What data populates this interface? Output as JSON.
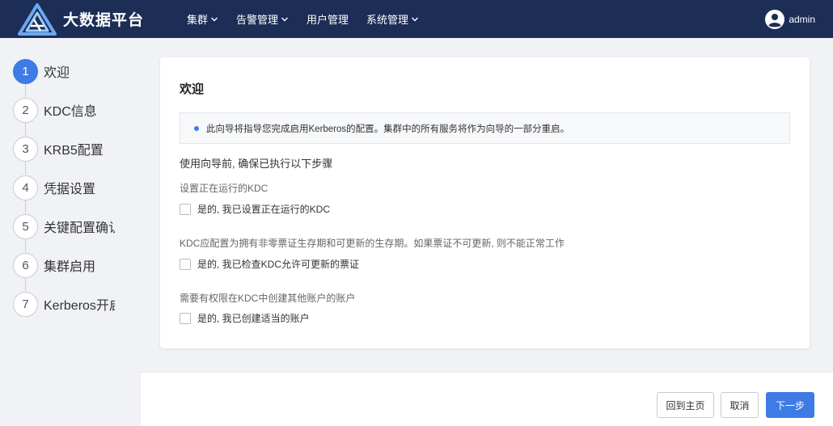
{
  "app": {
    "title": "大数据平台"
  },
  "nav": {
    "items": [
      {
        "label": "集群",
        "has_dropdown": true
      },
      {
        "label": "告警管理",
        "has_dropdown": true
      },
      {
        "label": "用户管理",
        "has_dropdown": false
      },
      {
        "label": "系统管理",
        "has_dropdown": true
      }
    ]
  },
  "user": {
    "name": "admin"
  },
  "steps": [
    {
      "number": "1",
      "label": "欢迎",
      "active": true
    },
    {
      "number": "2",
      "label": "KDC信息"
    },
    {
      "number": "3",
      "label": "KRB5配置"
    },
    {
      "number": "4",
      "label": "凭据设置"
    },
    {
      "number": "5",
      "label": "关键配置确认"
    },
    {
      "number": "6",
      "label": "集群启用"
    },
    {
      "number": "7",
      "label": "Kerberos开启"
    }
  ],
  "main": {
    "title": "欢迎",
    "info": "此向导将指导您完成启用Kerberos的配置。集群中的所有服务将作为向导的一部分重启。",
    "intro": "使用向导前, 确保已执行以下步骤",
    "sections": [
      {
        "label": "设置正在运行的KDC",
        "checkbox_label": "是的, 我已设置正在运行的KDC",
        "checked": false
      },
      {
        "label": "KDC应配置为拥有非零票证生存期和可更新的生存期。如果票证不可更新, 则不能正常工作",
        "checkbox_label": "是的, 我已检查KDC允许可更新的票证",
        "checked": false
      },
      {
        "label": "需要有权限在KDC中创建其他账户的账户",
        "checkbox_label": "是的, 我已创建适当的账户",
        "checked": false
      }
    ]
  },
  "footer": {
    "home_label": "回到主页",
    "cancel_label": "取消",
    "next_label": "下一步"
  },
  "colors": {
    "topbar": "#1c2d56",
    "accent": "#3f7be4",
    "background": "#f0f2f5"
  }
}
